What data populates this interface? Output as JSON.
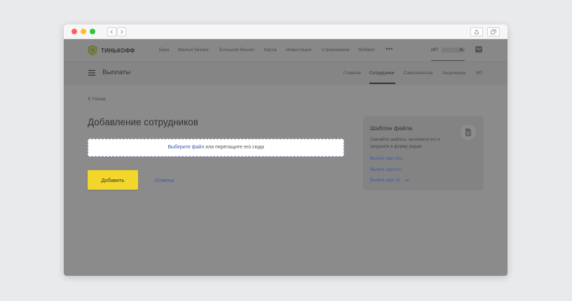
{
  "topnav": {
    "brand": "ТИНЬКОФФ",
    "links": [
      "Банк",
      "Малый бизнес",
      "Большой бизнес",
      "Касса",
      "Инвестиции",
      "Страхование",
      "Мобайл"
    ],
    "more": "•••",
    "account_prefix": "ИП",
    "account_suffix": "В."
  },
  "subnav": {
    "title": "Выплаты",
    "tabs": [
      "Главное",
      "Сотрудники",
      "Самозанятые",
      "Акционеры",
      "ИП"
    ],
    "active_tab": "Сотрудники"
  },
  "main": {
    "back_link": "Назад",
    "page_title": "Добавление сотрудников",
    "dropzone_link": "Выберите файл",
    "dropzone_text": " или перетащите его сюда",
    "add_button": "Добавить",
    "cancel_link": "Отмена"
  },
  "template_card": {
    "title": "Шаблон файла",
    "description": "Скачайте шаблон, заполните его и загрузите в форму рядом",
    "links": [
      "Выпуск карт.xlsx",
      "Выпуск карт.csv",
      "Выпуск карт 1с"
    ]
  },
  "colors": {
    "overlay": "#8b8b8b",
    "accent_yellow": "#f2d72a",
    "link_blue": "#3d5aa8"
  }
}
